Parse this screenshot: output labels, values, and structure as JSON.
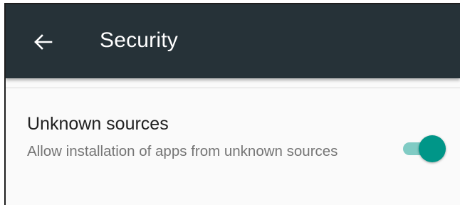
{
  "app_bar": {
    "back_icon": "arrow-back-icon",
    "title": "Security",
    "background_color": "#263238"
  },
  "setting": {
    "title": "Unknown sources",
    "summary": "Allow installation of apps from unknown sources",
    "toggle": {
      "state": "on",
      "accent_color": "#009688",
      "track_color": "#80cbc4"
    }
  }
}
